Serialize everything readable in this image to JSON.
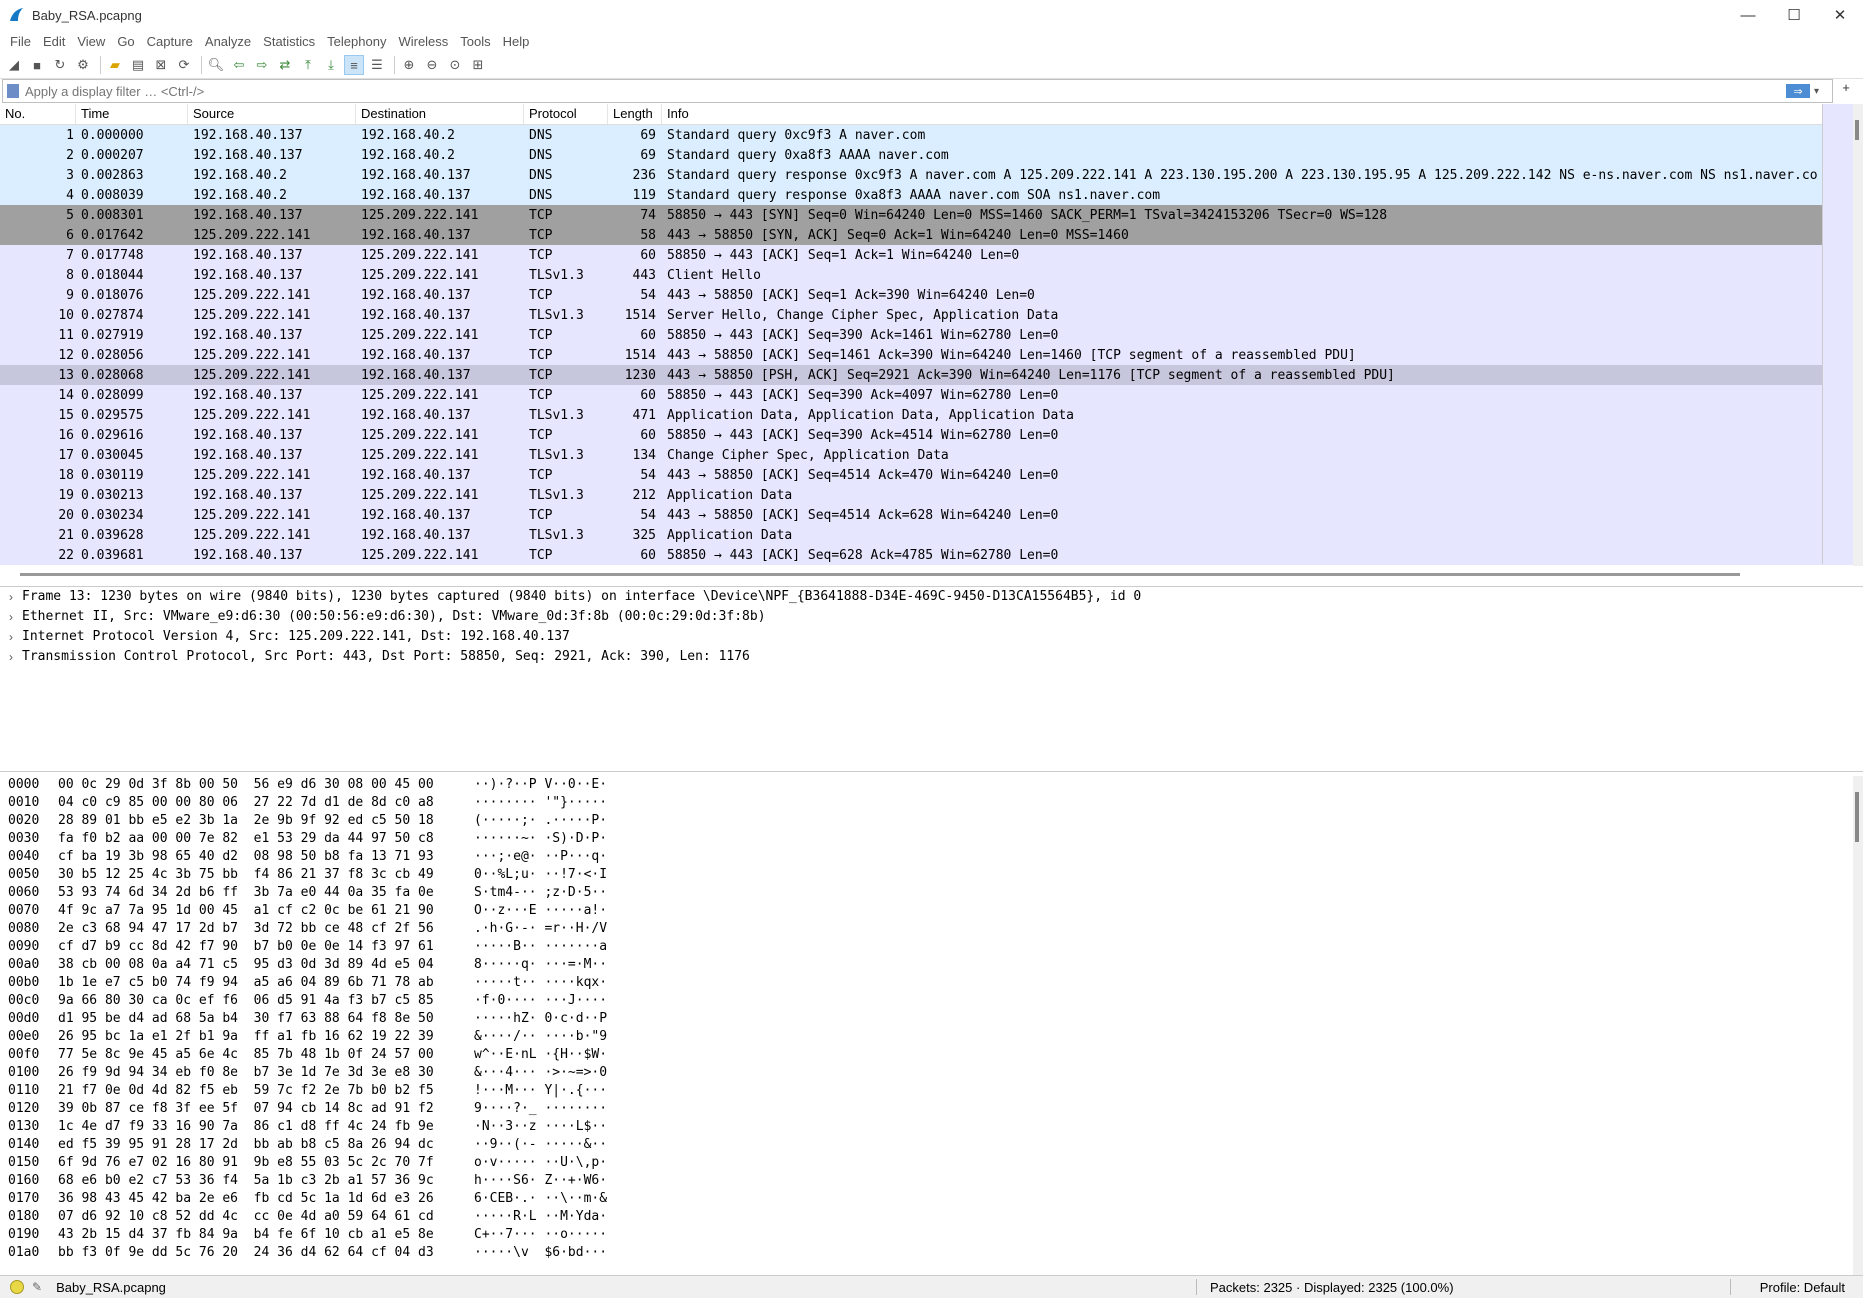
{
  "window": {
    "title": "Baby_RSA.pcapng"
  },
  "menu": [
    "File",
    "Edit",
    "View",
    "Go",
    "Capture",
    "Analyze",
    "Statistics",
    "Telephony",
    "Wireless",
    "Tools",
    "Help"
  ],
  "filter": {
    "placeholder": "Apply a display filter … <Ctrl-/>"
  },
  "columns": [
    "No.",
    "Time",
    "Source",
    "Destination",
    "Protocol",
    "Length",
    "Info"
  ],
  "packets": [
    {
      "no": "1",
      "time": "0.000000",
      "src": "192.168.40.137",
      "dst": "192.168.40.2",
      "proto": "DNS",
      "len": "69",
      "info": "Standard query 0xc9f3 A naver.com"
    },
    {
      "no": "2",
      "time": "0.000207",
      "src": "192.168.40.137",
      "dst": "192.168.40.2",
      "proto": "DNS",
      "len": "69",
      "info": "Standard query 0xa8f3 AAAA naver.com"
    },
    {
      "no": "3",
      "time": "0.002863",
      "src": "192.168.40.2",
      "dst": "192.168.40.137",
      "proto": "DNS",
      "len": "236",
      "info": "Standard query response 0xc9f3 A naver.com A 125.209.222.141 A 223.130.195.200 A 223.130.195.95 A 125.209.222.142 NS e-ns.naver.com NS ns1.naver.co"
    },
    {
      "no": "4",
      "time": "0.008039",
      "src": "192.168.40.2",
      "dst": "192.168.40.137",
      "proto": "DNS",
      "len": "119",
      "info": "Standard query response 0xa8f3 AAAA naver.com SOA ns1.naver.com"
    },
    {
      "no": "5",
      "time": "0.008301",
      "src": "192.168.40.137",
      "dst": "125.209.222.141",
      "proto": "TCP",
      "len": "74",
      "info": "58850 → 443 [SYN] Seq=0 Win=64240 Len=0 MSS=1460 SACK_PERM=1 TSval=3424153206 TSecr=0 WS=128"
    },
    {
      "no": "6",
      "time": "0.017642",
      "src": "125.209.222.141",
      "dst": "192.168.40.137",
      "proto": "TCP",
      "len": "58",
      "info": "443 → 58850 [SYN, ACK] Seq=0 Ack=1 Win=64240 Len=0 MSS=1460"
    },
    {
      "no": "7",
      "time": "0.017748",
      "src": "192.168.40.137",
      "dst": "125.209.222.141",
      "proto": "TCP",
      "len": "60",
      "info": "58850 → 443 [ACK] Seq=1 Ack=1 Win=64240 Len=0"
    },
    {
      "no": "8",
      "time": "0.018044",
      "src": "192.168.40.137",
      "dst": "125.209.222.141",
      "proto": "TLSv1.3",
      "len": "443",
      "info": "Client Hello"
    },
    {
      "no": "9",
      "time": "0.018076",
      "src": "125.209.222.141",
      "dst": "192.168.40.137",
      "proto": "TCP",
      "len": "54",
      "info": "443 → 58850 [ACK] Seq=1 Ack=390 Win=64240 Len=0"
    },
    {
      "no": "10",
      "time": "0.027874",
      "src": "125.209.222.141",
      "dst": "192.168.40.137",
      "proto": "TLSv1.3",
      "len": "1514",
      "info": "Server Hello, Change Cipher Spec, Application Data"
    },
    {
      "no": "11",
      "time": "0.027919",
      "src": "192.168.40.137",
      "dst": "125.209.222.141",
      "proto": "TCP",
      "len": "60",
      "info": "58850 → 443 [ACK] Seq=390 Ack=1461 Win=62780 Len=0"
    },
    {
      "no": "12",
      "time": "0.028056",
      "src": "125.209.222.141",
      "dst": "192.168.40.137",
      "proto": "TCP",
      "len": "1514",
      "info": "443 → 58850 [ACK] Seq=1461 Ack=390 Win=64240 Len=1460 [TCP segment of a reassembled PDU]"
    },
    {
      "no": "13",
      "time": "0.028068",
      "src": "125.209.222.141",
      "dst": "192.168.40.137",
      "proto": "TCP",
      "len": "1230",
      "info": "443 → 58850 [PSH, ACK] Seq=2921 Ack=390 Win=64240 Len=1176 [TCP segment of a reassembled PDU]"
    },
    {
      "no": "14",
      "time": "0.028099",
      "src": "192.168.40.137",
      "dst": "125.209.222.141",
      "proto": "TCP",
      "len": "60",
      "info": "58850 → 443 [ACK] Seq=390 Ack=4097 Win=62780 Len=0"
    },
    {
      "no": "15",
      "time": "0.029575",
      "src": "125.209.222.141",
      "dst": "192.168.40.137",
      "proto": "TLSv1.3",
      "len": "471",
      "info": "Application Data, Application Data, Application Data"
    },
    {
      "no": "16",
      "time": "0.029616",
      "src": "192.168.40.137",
      "dst": "125.209.222.141",
      "proto": "TCP",
      "len": "60",
      "info": "58850 → 443 [ACK] Seq=390 Ack=4514 Win=62780 Len=0"
    },
    {
      "no": "17",
      "time": "0.030045",
      "src": "192.168.40.137",
      "dst": "125.209.222.141",
      "proto": "TLSv1.3",
      "len": "134",
      "info": "Change Cipher Spec, Application Data"
    },
    {
      "no": "18",
      "time": "0.030119",
      "src": "125.209.222.141",
      "dst": "192.168.40.137",
      "proto": "TCP",
      "len": "54",
      "info": "443 → 58850 [ACK] Seq=4514 Ack=470 Win=64240 Len=0"
    },
    {
      "no": "19",
      "time": "0.030213",
      "src": "192.168.40.137",
      "dst": "125.209.222.141",
      "proto": "TLSv1.3",
      "len": "212",
      "info": "Application Data"
    },
    {
      "no": "20",
      "time": "0.030234",
      "src": "125.209.222.141",
      "dst": "192.168.40.137",
      "proto": "TCP",
      "len": "54",
      "info": "443 → 58850 [ACK] Seq=4514 Ack=628 Win=64240 Len=0"
    },
    {
      "no": "21",
      "time": "0.039628",
      "src": "125.209.222.141",
      "dst": "192.168.40.137",
      "proto": "TLSv1.3",
      "len": "325",
      "info": "Application Data"
    },
    {
      "no": "22",
      "time": "0.039681",
      "src": "192.168.40.137",
      "dst": "125.209.222.141",
      "proto": "TCP",
      "len": "60",
      "info": "58850 → 443 [ACK] Seq=628 Ack=4785 Win=62780 Len=0"
    }
  ],
  "row_colors": {
    "dns": "#daeeff",
    "tcp": "#e7e6ff",
    "dark": "#a0a0a0",
    "selected": "#c6c6dd"
  },
  "details": [
    "Frame 13: 1230 bytes on wire (9840 bits), 1230 bytes captured (9840 bits) on interface \\Device\\NPF_{B3641888-D34E-469C-9450-D13CA15564B5}, id 0",
    "Ethernet II, Src: VMware_e9:d6:30 (00:50:56:e9:d6:30), Dst: VMware_0d:3f:8b (00:0c:29:0d:3f:8b)",
    "Internet Protocol Version 4, Src: 125.209.222.141, Dst: 192.168.40.137",
    "Transmission Control Protocol, Src Port: 443, Dst Port: 58850, Seq: 2921, Ack: 390, Len: 1176"
  ],
  "bytes": [
    {
      "off": "0000",
      "hex": "00 0c 29 0d 3f 8b 00 50  56 e9 d6 30 08 00 45 00",
      "asc": "··)·?··P V··0··E·"
    },
    {
      "off": "0010",
      "hex": "04 c0 c9 85 00 00 80 06  27 22 7d d1 de 8d c0 a8",
      "asc": "········ '\"}·····"
    },
    {
      "off": "0020",
      "hex": "28 89 01 bb e5 e2 3b 1a  2e 9b 9f 92 ed c5 50 18",
      "asc": "(·····;· .·····P·"
    },
    {
      "off": "0030",
      "hex": "fa f0 b2 aa 00 00 7e 82  e1 53 29 da 44 97 50 c8",
      "asc": "······~· ·S)·D·P·"
    },
    {
      "off": "0040",
      "hex": "cf ba 19 3b 98 65 40 d2  08 98 50 b8 fa 13 71 93",
      "asc": "···;·e@· ··P···q·"
    },
    {
      "off": "0050",
      "hex": "30 b5 12 25 4c 3b 75 bb  f4 86 21 37 f8 3c cb 49",
      "asc": "0··%L;u· ··!7·<·I"
    },
    {
      "off": "0060",
      "hex": "53 93 74 6d 34 2d b6 ff  3b 7a e0 44 0a 35 fa 0e",
      "asc": "S·tm4-·· ;z·D·5··"
    },
    {
      "off": "0070",
      "hex": "4f 9c a7 7a 95 1d 00 45  a1 cf c2 0c be 61 21 90",
      "asc": "O··z···E ·····a!·"
    },
    {
      "off": "0080",
      "hex": "2e c3 68 94 47 17 2d b7  3d 72 bb ce 48 cf 2f 56",
      "asc": ".·h·G·-· =r··H·/V"
    },
    {
      "off": "0090",
      "hex": "cf d7 b9 cc 8d 42 f7 90  b7 b0 0e 0e 14 f3 97 61",
      "asc": "·····B·· ·······a"
    },
    {
      "off": "00a0",
      "hex": "38 cb 00 08 0a a4 71 c5  95 d3 0d 3d 89 4d e5 04",
      "asc": "8·····q· ···=·M··"
    },
    {
      "off": "00b0",
      "hex": "1b 1e e7 c5 b0 74 f9 94  a5 a6 04 89 6b 71 78 ab",
      "asc": "·····t·· ····kqx·"
    },
    {
      "off": "00c0",
      "hex": "9a 66 80 30 ca 0c ef f6  06 d5 91 4a f3 b7 c5 85",
      "asc": "·f·0···· ···J····"
    },
    {
      "off": "00d0",
      "hex": "d1 95 be d4 ad 68 5a b4  30 f7 63 88 64 f8 8e 50",
      "asc": "·····hZ· 0·c·d··P"
    },
    {
      "off": "00e0",
      "hex": "26 95 bc 1a e1 2f b1 9a  ff a1 fb 16 62 19 22 39",
      "asc": "&····/·· ····b·\"9"
    },
    {
      "off": "00f0",
      "hex": "77 5e 8c 9e 45 a5 6e 4c  85 7b 48 1b 0f 24 57 00",
      "asc": "w^··E·nL ·{H··$W·"
    },
    {
      "off": "0100",
      "hex": "26 f9 9d 94 34 eb f0 8e  b7 3e 1d 7e 3d 3e e8 30",
      "asc": "&···4··· ·>·~=>·0"
    },
    {
      "off": "0110",
      "hex": "21 f7 0e 0d 4d 82 f5 eb  59 7c f2 2e 7b b0 b2 f5",
      "asc": "!···M··· Y|·.{···"
    },
    {
      "off": "0120",
      "hex": "39 0b 87 ce f8 3f ee 5f  07 94 cb 14 8c ad 91 f2",
      "asc": "9····?·_ ········"
    },
    {
      "off": "0130",
      "hex": "1c 4e d7 f9 33 16 90 7a  86 c1 d8 ff 4c 24 fb 9e",
      "asc": "·N··3··z ····L$··"
    },
    {
      "off": "0140",
      "hex": "ed f5 39 95 91 28 17 2d  bb ab b8 c5 8a 26 94 dc",
      "asc": "··9··(·- ·····&··"
    },
    {
      "off": "0150",
      "hex": "6f 9d 76 e7 02 16 80 91  9b e8 55 03 5c 2c 70 7f",
      "asc": "o·v····· ··U·\\,p·"
    },
    {
      "off": "0160",
      "hex": "68 e6 b0 e2 c7 53 36 f4  5a 1b c3 2b a1 57 36 9c",
      "asc": "h····S6· Z··+·W6·"
    },
    {
      "off": "0170",
      "hex": "36 98 43 45 42 ba 2e e6  fb cd 5c 1a 1d 6d e3 26",
      "asc": "6·CEB·.· ··\\··m·&"
    },
    {
      "off": "0180",
      "hex": "07 d6 92 10 c8 52 dd 4c  cc 0e 4d a0 59 64 61 cd",
      "asc": "·····R·L ··M·Yda·"
    },
    {
      "off": "0190",
      "hex": "43 2b 15 d4 37 fb 84 9a  b4 fe 6f 10 cb a1 e5 8e",
      "asc": "C+··7··· ··o·····"
    },
    {
      "off": "01a0",
      "hex": "bb f3 0f 9e dd 5c 76 20  24 36 d4 62 64 cf 04 d3",
      "asc": "·····\\v  $6·bd···"
    }
  ],
  "status": {
    "file": "Baby_RSA.pcapng",
    "packets": "Packets: 2325 · Displayed: 2325 (100.0%)",
    "profile": "Profile: Default"
  }
}
